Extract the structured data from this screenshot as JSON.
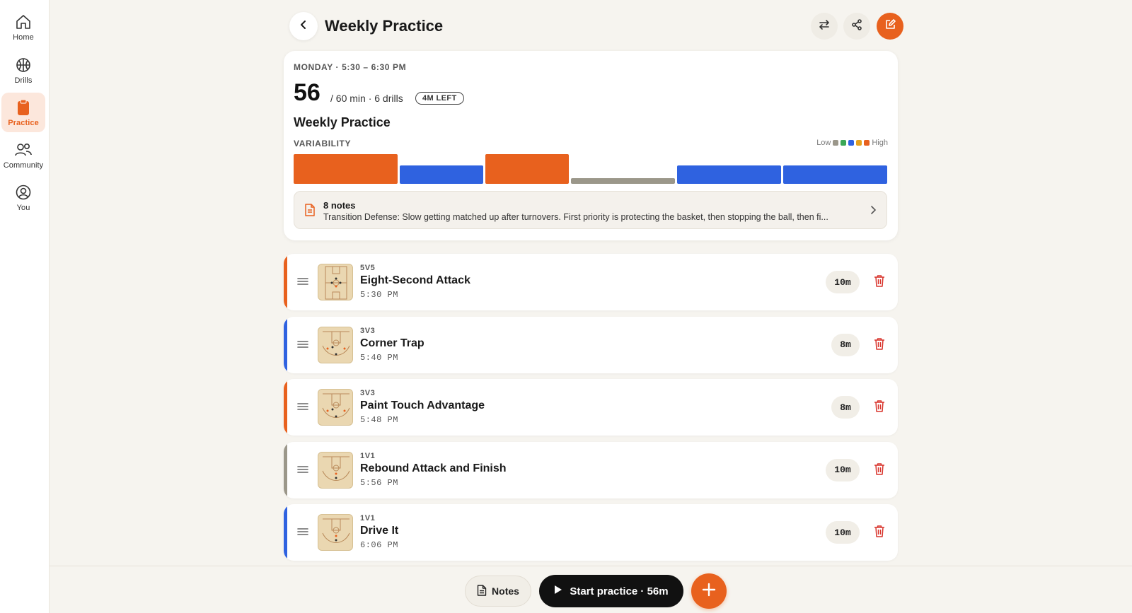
{
  "colors": {
    "accent": "#e8611e",
    "blue": "#2f62e0",
    "grey": "#9b978a",
    "green": "#3aa757",
    "yellow": "#e6a21e"
  },
  "nav": [
    {
      "label": "Home",
      "icon": "home-icon"
    },
    {
      "label": "Drills",
      "icon": "basketball-icon"
    },
    {
      "label": "Practice",
      "icon": "clipboard-icon",
      "active": true
    },
    {
      "label": "Community",
      "icon": "people-icon"
    },
    {
      "label": "You",
      "icon": "user-icon"
    }
  ],
  "header": {
    "title": "Weekly Practice",
    "icons": [
      "back-arrow-icon",
      "swap-icon",
      "share-icon",
      "edit-icon"
    ]
  },
  "summary": {
    "schedule": "MONDAY · 5:30 – 6:30 PM",
    "total": "56",
    "meta": "/ 60 min · 6 drills",
    "remaining": "4M LEFT",
    "title": "Weekly Practice",
    "variability_label": "VARIABILITY",
    "legend_low": "Low",
    "legend_high": "High",
    "notes_count": "8 notes",
    "notes_preview": "Transition Defense: Slow getting matched up after turnovers. First priority is protecting the basket, then stopping the ball, then fi..."
  },
  "variability": [
    {
      "minutes": 10,
      "level": "high"
    },
    {
      "minutes": 8,
      "level": "medium"
    },
    {
      "minutes": 8,
      "level": "high"
    },
    {
      "minutes": 10,
      "level": "low"
    },
    {
      "minutes": 10,
      "level": "medium"
    },
    {
      "minutes": 10,
      "level": "medium"
    }
  ],
  "drills": [
    {
      "type": "5V5",
      "name": "Eight-Second Attack",
      "time": "5:30 PM",
      "duration": "10m",
      "level": "high"
    },
    {
      "type": "3V3",
      "name": "Corner Trap",
      "time": "5:40 PM",
      "duration": "8m",
      "level": "medium"
    },
    {
      "type": "3V3",
      "name": "Paint Touch Advantage",
      "time": "5:48 PM",
      "duration": "8m",
      "level": "high"
    },
    {
      "type": "1V1",
      "name": "Rebound Attack and Finish",
      "time": "5:56 PM",
      "duration": "10m",
      "level": "low"
    },
    {
      "type": "1V1",
      "name": "Drive It",
      "time": "6:06 PM",
      "duration": "10m",
      "level": "medium"
    }
  ],
  "bottom": {
    "notes_label": "Notes",
    "start_label": "Start practice · 56m"
  }
}
